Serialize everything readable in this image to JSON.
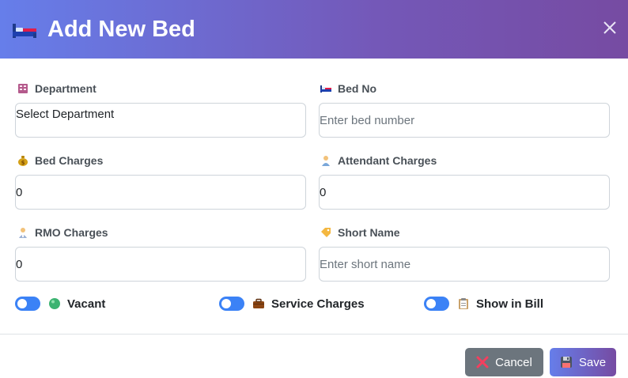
{
  "modal": {
    "title": "Add New Bed",
    "title_icon": "bed-icon",
    "close_icon": "close-icon"
  },
  "form": {
    "department": {
      "label": "Department",
      "icon": "building-icon",
      "value": "Select Department"
    },
    "bed_no": {
      "label": "Bed No",
      "icon": "bed-icon",
      "value": "",
      "placeholder": "Enter bed number"
    },
    "bed_charges": {
      "label": "Bed Charges",
      "icon": "money-bag-icon",
      "value": "0"
    },
    "attendant_charges": {
      "label": "Attendant Charges",
      "icon": "person-icon",
      "value": "0"
    },
    "rmo_charges": {
      "label": "RMO Charges",
      "icon": "doctor-icon",
      "value": "0"
    },
    "short_name": {
      "label": "Short Name",
      "icon": "tag-icon",
      "value": "",
      "placeholder": "Enter short name"
    }
  },
  "toggles": [
    {
      "label": "Vacant",
      "icon": "green-circle-icon",
      "on": true
    },
    {
      "label": "Service Charges",
      "icon": "briefcase-icon",
      "on": true
    },
    {
      "label": "Show in Bill",
      "icon": "clipboard-icon",
      "on": true
    }
  ],
  "footer": {
    "cancel_label": "Cancel",
    "save_label": "Save"
  },
  "colors": {
    "header_gradient_start": "#667eea",
    "header_gradient_end": "#764ba2",
    "toggle_on": "#3b82f6",
    "cancel_bg": "#6c757d"
  }
}
